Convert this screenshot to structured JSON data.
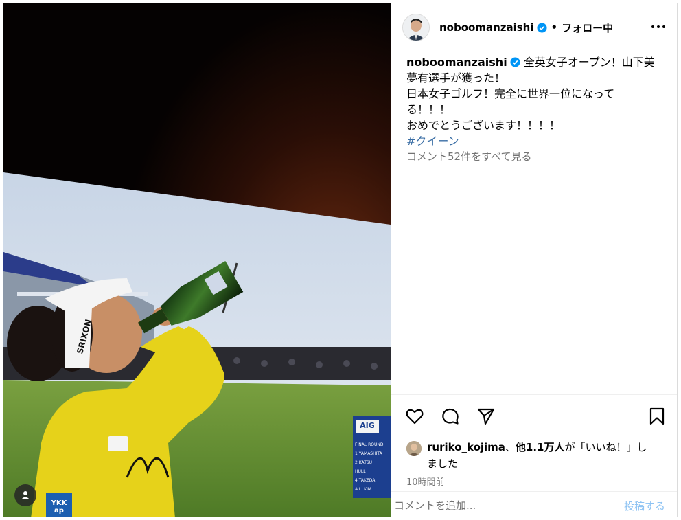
{
  "header": {
    "username": "noboomanzaishi",
    "separator": "•",
    "follow_status": "フォロー中",
    "more_icon": "more-horizontal-icon",
    "verified_icon": "verified-badge-icon"
  },
  "caption": {
    "username": "noboomanzaishi",
    "lines": [
      "全英女子オープン！山下美",
      "夢有選手が獲った！",
      "日本女子ゴルフ！完全に世界一位になって",
      "る！！！",
      "おめでとうございます！！！！"
    ],
    "hashtag": "#クイーン"
  },
  "comments": {
    "view_all": "コメント52件をすべて見る"
  },
  "actions": {
    "like_icon": "heart-icon",
    "comment_icon": "comment-icon",
    "share_icon": "send-icon",
    "save_icon": "bookmark-icon"
  },
  "likes": {
    "user": "ruriko_kojima",
    "joiner": "、",
    "others": "他1.1万人",
    "suffix_1": "が「いいね！」し",
    "suffix_2": "ました"
  },
  "timestamp": "10時間前",
  "comment_box": {
    "placeholder": "コメントを追加...",
    "post_label": "投稿する"
  },
  "media": {
    "tag_icon": "user-tag-icon",
    "scoreboard": {
      "brand": "AIG",
      "title": "FINAL ROUND",
      "rows": [
        "1 YAMASHITA",
        "2 KATSU",
        "HULL",
        "4 TAKEDA",
        "A.L. KIM"
      ]
    },
    "visor_text": "SRIXON",
    "sleeve_text": "YKK ap"
  },
  "colors": {
    "accent": "#0095f6",
    "post_disabled": "#8ec3f3",
    "hashtag": "#00376b",
    "shirt": "#e8d21c",
    "grass": "#5e8a2e"
  }
}
